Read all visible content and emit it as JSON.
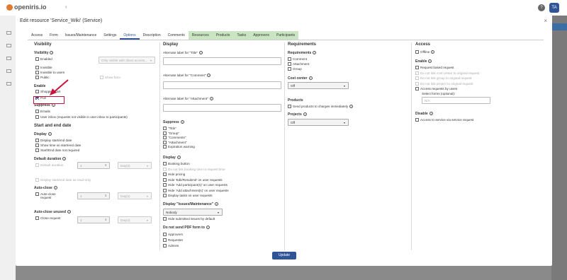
{
  "app": {
    "logo_text": "openiris.io",
    "collapse_glyph": "‹",
    "help_glyph": "?",
    "avatar_initials": "TA"
  },
  "modal": {
    "title": "Edit resource 'Service_Wiki' (Service)",
    "close_glyph": "×",
    "tabs": [
      {
        "label": "Access",
        "active": false,
        "green": false
      },
      {
        "label": "Form",
        "active": false,
        "green": false
      },
      {
        "label": "Issues/Maintenance",
        "active": false,
        "green": false
      },
      {
        "label": "Settings",
        "active": false,
        "green": false
      },
      {
        "label": "Options",
        "active": true,
        "green": false
      },
      {
        "label": "Description",
        "active": false,
        "green": false
      },
      {
        "label": "Comments",
        "active": false,
        "green": false
      },
      {
        "label": "Resources",
        "active": false,
        "green": true
      },
      {
        "label": "Products",
        "active": false,
        "green": true
      },
      {
        "label": "Tasks",
        "active": false,
        "green": true
      },
      {
        "label": "Approvers",
        "active": false,
        "green": true
      },
      {
        "label": "Participants",
        "active": false,
        "green": true
      }
    ],
    "update_label": "Update"
  },
  "visibility": {
    "heading": "Visibility",
    "sub": "Visibility",
    "enabled": "Enabled",
    "enabled_select": "Only visible with direct access...",
    "invisible": "Invisible",
    "invisible_users": "Invisible to users",
    "public": "Public",
    "show_form": "Show form",
    "enable": "Enable",
    "shopping_cart": "Shopping cart",
    "poll": "Poll",
    "suppress": "Suppress",
    "emails": "Emails",
    "user_inbox": "User inbox (requests not visible in user inbox to participants)"
  },
  "start_end": {
    "heading": "Start and end date",
    "display": "Display",
    "display_start_end": "Display start/end date",
    "show_time": "Show time on start/end date",
    "not_required": "Start/End date not required",
    "default_duration": "Default duration",
    "default_duration_cb": "Default duration",
    "duration_value": "1",
    "duration_unit": "Day(s)",
    "readonly": "Display start/end date as read-only",
    "auto_close": "Auto-close",
    "auto_close_cb": "Auto-close request",
    "auto_close_value": "1",
    "auto_close_unit": "Day(s)",
    "auto_close_unused": "Auto-close unused",
    "close_request": "Close request",
    "close_value": "1",
    "close_unit": "Day(s)"
  },
  "display": {
    "heading": "Display",
    "alt_title": "Alternate label for \"Title\"",
    "alt_comment": "Alternate label for \"Comment\"",
    "alt_attachment": "Alternate label for \"Attachment\"",
    "suppress": "Suppress",
    "suppress_items": [
      "\"Title\"",
      "\"Group\"",
      "\"Comments\"",
      "\"Attachment\"",
      "Expiration warning"
    ],
    "display_sub": "Display",
    "display_items": [
      {
        "label": "Booking button",
        "disabled": false
      },
      {
        "label": "Do not link booking time to request time",
        "disabled": true
      },
      {
        "label": "Hide pricing",
        "disabled": false
      },
      {
        "label": "Hide 'Edit/Resubmit' on user requests",
        "disabled": false
      },
      {
        "label": "Hide 'Add participant(s)' on user requests",
        "disabled": false
      },
      {
        "label": "Hide 'Add attachment(s)' on user requests",
        "disabled": false
      },
      {
        "label": "Display tasks on user requests",
        "disabled": false
      }
    ],
    "issues_heading": "Display \"Issues/Maintenance\"",
    "issues_select": "Nobody",
    "hide_submitted": "Hide submitted issues by default",
    "no_pdf": "Do not send PDF form to",
    "pdf_items": [
      "Approvers",
      "Requester",
      "Admins"
    ]
  },
  "requirements": {
    "heading": "Requirements",
    "sub": "Requirements",
    "items": [
      "Comment",
      "Attachment",
      "Group"
    ],
    "cost_center": "Cost center",
    "cost_select": "Off",
    "products": "Products",
    "send_products": "Send products to charges immediately",
    "projects": "Projects",
    "projects_select": "Off"
  },
  "access": {
    "heading": "Access",
    "offline": "Offline",
    "enable": "Enable",
    "items": [
      {
        "label": "Request based request",
        "disabled": false
      },
      {
        "label": "Do not link cost center to original request",
        "disabled": true
      },
      {
        "label": "Do not link group to original request",
        "disabled": true
      },
      {
        "label": "Do not link project to original request",
        "disabled": true
      },
      {
        "label": "Access requests by users",
        "disabled": false
      }
    ],
    "select_forms": "Select forms (optional):",
    "forms_value": "N/A",
    "disable": "Disable",
    "access_service": "Access to service via service request"
  }
}
